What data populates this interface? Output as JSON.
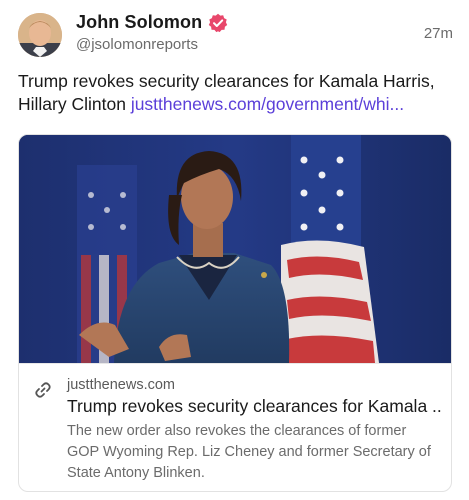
{
  "author": {
    "display_name": "John Solomon",
    "handle": "@jsolomonreports",
    "avatar_icon": "avatar-photo",
    "verified_icon": "verified-badge-icon",
    "verified_color": "#e8476b"
  },
  "post": {
    "timestamp": "27m",
    "text": "Trump revokes security clearances for Kamala Harris, Hillary Clinton ",
    "link_text": "justthenews.com/government/whi..."
  },
  "link_card": {
    "image_icon": "article-photo",
    "link_icon": "link-icon",
    "domain": "justthenews.com",
    "title": "Trump revokes security clearances for Kamala ...",
    "description": "The new order also revokes the clearances of former GOP Wyoming Rep. Liz Cheney and former Secretary of State Antony Blinken."
  },
  "colors": {
    "link": "#5b3fd9",
    "text_primary": "#1a1a1a",
    "text_secondary": "#6b6b6b",
    "border": "#e2e2e2"
  }
}
